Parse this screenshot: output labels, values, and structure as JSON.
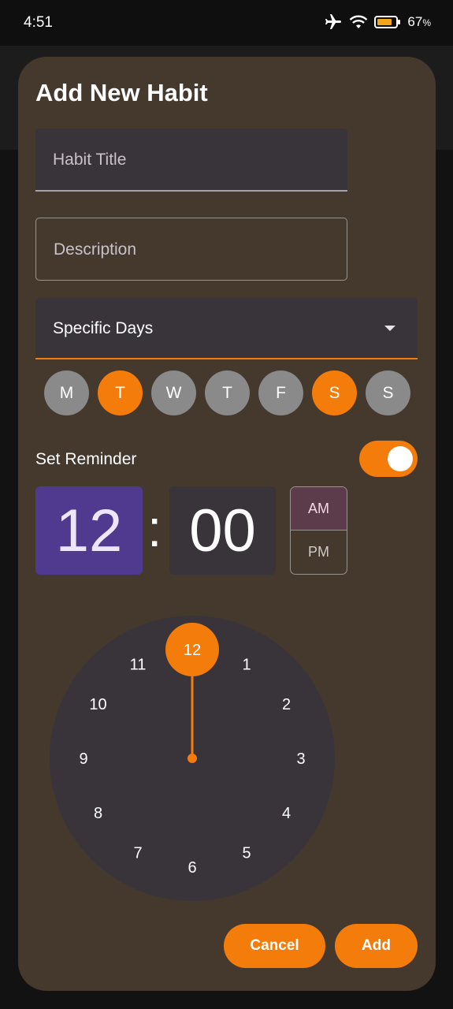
{
  "status_bar": {
    "time": "4:51",
    "battery_percent": "67",
    "battery_unit": "%",
    "icons": [
      "airplane-icon",
      "wifi-icon",
      "battery-icon"
    ]
  },
  "dialog": {
    "title": "Add New Habit",
    "habit_title_placeholder": "Habit Title",
    "description_placeholder": "Description",
    "frequency_value": "Specific Days",
    "days": [
      {
        "label": "M",
        "selected": false
      },
      {
        "label": "T",
        "selected": true
      },
      {
        "label": "W",
        "selected": false
      },
      {
        "label": "T",
        "selected": false
      },
      {
        "label": "F",
        "selected": false
      },
      {
        "label": "S",
        "selected": true
      },
      {
        "label": "S",
        "selected": false
      }
    ],
    "reminder_label": "Set Reminder",
    "reminder_enabled": true,
    "time_picker": {
      "hour": "12",
      "separator": ":",
      "minute": "00",
      "am_label": "AM",
      "pm_label": "PM",
      "period_selected": "AM",
      "dial_numbers": [
        "12",
        "1",
        "2",
        "3",
        "4",
        "5",
        "6",
        "7",
        "8",
        "9",
        "10",
        "11"
      ],
      "selected_number": "12"
    },
    "cancel_label": "Cancel",
    "add_label": "Add"
  },
  "colors": {
    "accent": "#f47c0b",
    "dialog_bg": "#45392e",
    "field_bg": "#38343a",
    "hour_selected_bg": "#4f3a8f",
    "am_selected_bg": "#5c3b4b",
    "day_unselected": "#8a8a8a"
  }
}
